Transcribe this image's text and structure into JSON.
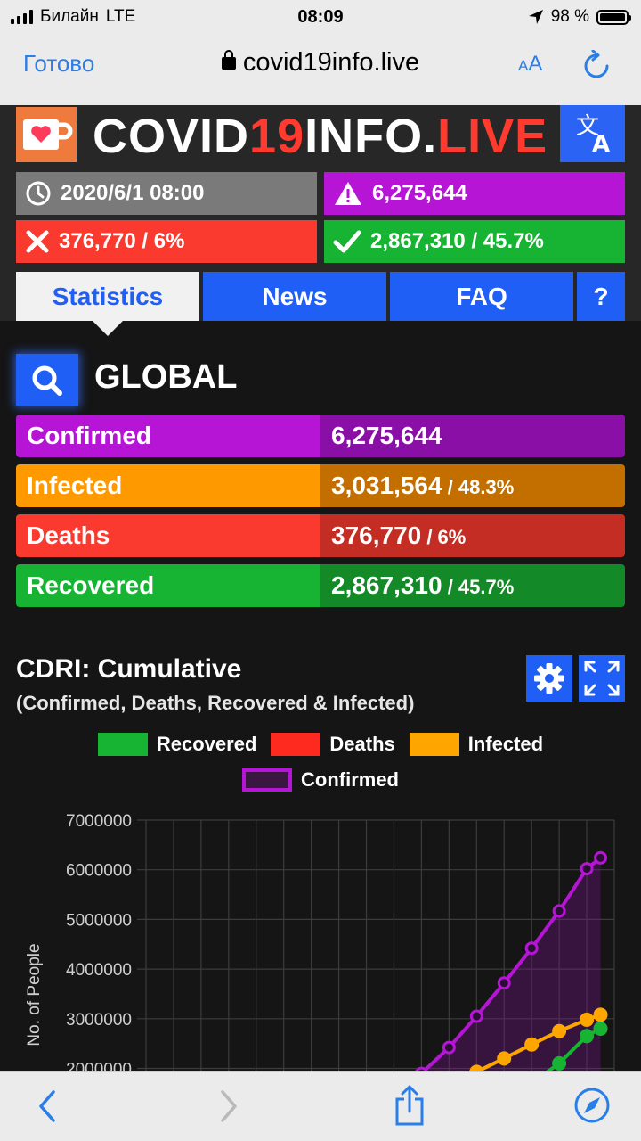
{
  "status_bar": {
    "carrier": "Билайн",
    "network": "LTE",
    "time": "08:09",
    "battery": "98 %"
  },
  "browser": {
    "done_label": "Готово",
    "url": "covid19info.live",
    "text_size_label_small": "A",
    "text_size_label_big": "A"
  },
  "header": {
    "title_part1": "COVID",
    "title_part2": "19",
    "title_part3": "INFO.",
    "title_part4": "LIVE",
    "date": "2020/6/1 08:00",
    "confirmed": "6,275,644",
    "deaths": "376,770 / 6%",
    "recovered": "2,867,310 / 45.7%"
  },
  "tabs": [
    {
      "label": "Statistics",
      "active": true
    },
    {
      "label": "News"
    },
    {
      "label": "FAQ"
    },
    {
      "label": "?"
    }
  ],
  "global": {
    "title": "GLOBAL",
    "rows": [
      {
        "label": "Confirmed",
        "value": "6,275,644",
        "pct": ""
      },
      {
        "label": "Infected",
        "value": "3,031,564",
        "pct": " / 48.3%"
      },
      {
        "label": "Deaths",
        "value": "376,770",
        "pct": " / 6%"
      },
      {
        "label": "Recovered",
        "value": "2,867,310",
        "pct": " / 45.7%"
      }
    ]
  },
  "chart_section": {
    "title": "CDRI: Cumulative",
    "subtitle": "(Confirmed, Deaths, Recovered & Infected)"
  },
  "colors": {
    "accent_blue": "#1f5ff6",
    "confirmed": "#b615d6",
    "infected": "#ff9900",
    "deaths": "#fb3a2f",
    "recovered": "#17b434",
    "browser_blue": "#2a7ee8"
  },
  "chart_data": {
    "type": "line",
    "title": "",
    "xlabel": "",
    "ylabel": "No. of People",
    "ylim": [
      2000000,
      7000000
    ],
    "y_ticks": [
      7000000,
      6000000,
      5000000,
      4000000,
      3000000,
      2000000
    ],
    "grid": true,
    "legend": "top-center",
    "x_count": 17,
    "series": [
      {
        "name": "Recovered",
        "color": "#17b434",
        "x": [
          14,
          15,
          16,
          16.5
        ],
        "values": [
          1700000,
          2100000,
          2650000,
          2800000
        ]
      },
      {
        "name": "Deaths",
        "color": "#fb3a2f",
        "x": [],
        "values": []
      },
      {
        "name": "Infected",
        "color": "#ffa500",
        "x": [
          12,
          13,
          14,
          15,
          16,
          16.5
        ],
        "values": [
          1930000,
          2200000,
          2480000,
          2750000,
          2980000,
          3080000
        ]
      },
      {
        "name": "Confirmed",
        "color": "#b615d6",
        "fill": "rgba(120,20,140,0.35)",
        "x": [
          10,
          11,
          12,
          13,
          14,
          15,
          16,
          16.5
        ],
        "values": [
          1900000,
          2420000,
          3050000,
          3720000,
          4420000,
          5170000,
          6020000,
          6240000
        ]
      }
    ]
  }
}
